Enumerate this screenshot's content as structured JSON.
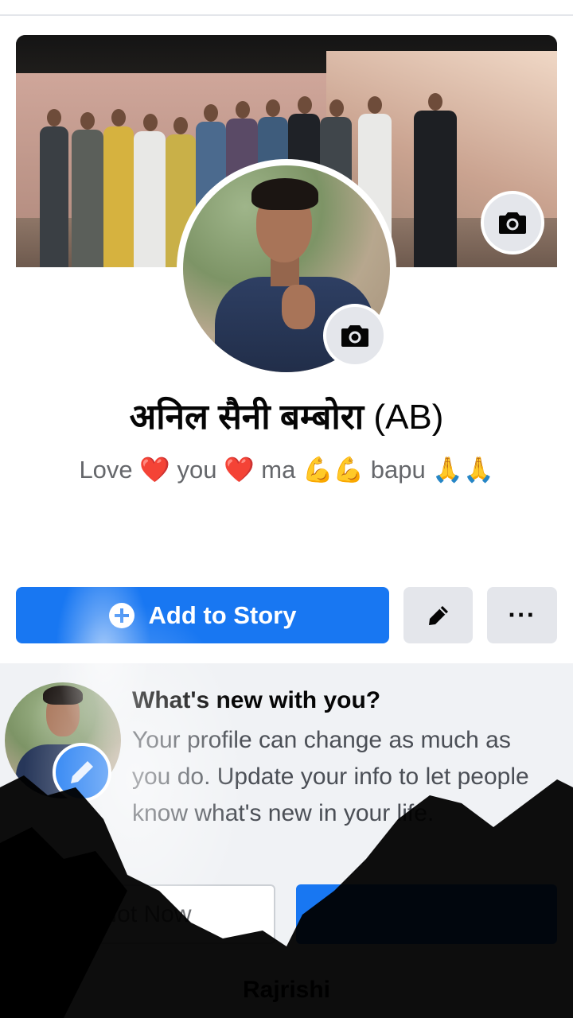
{
  "profile": {
    "name": "अनिल सैनी बम्बोरा",
    "name_suffix": "(AB)",
    "bio": "Love ❤️ you ❤️ ma 💪💪 bapu 🙏🙏"
  },
  "actions": {
    "add_story_label": "Add to Story",
    "more_label": "···"
  },
  "prompt_card": {
    "title": "What's new with you?",
    "body": "Your profile can change as much as you do. Update your info to let people know what's new in your life.",
    "not_now_label": "Not Now",
    "update_label": "",
    "below_text": "Rajrishi"
  },
  "icons": {
    "cover_camera": "camera-icon",
    "avatar_camera": "camera-icon",
    "edit": "pencil-icon",
    "more": "more-icon",
    "add": "plus-circle-icon",
    "pencil_badge": "pencil-icon"
  },
  "colors": {
    "brand_blue": "#1877f2",
    "secondary_button": "#e4e6eb",
    "card_background": "#f0f2f5"
  }
}
